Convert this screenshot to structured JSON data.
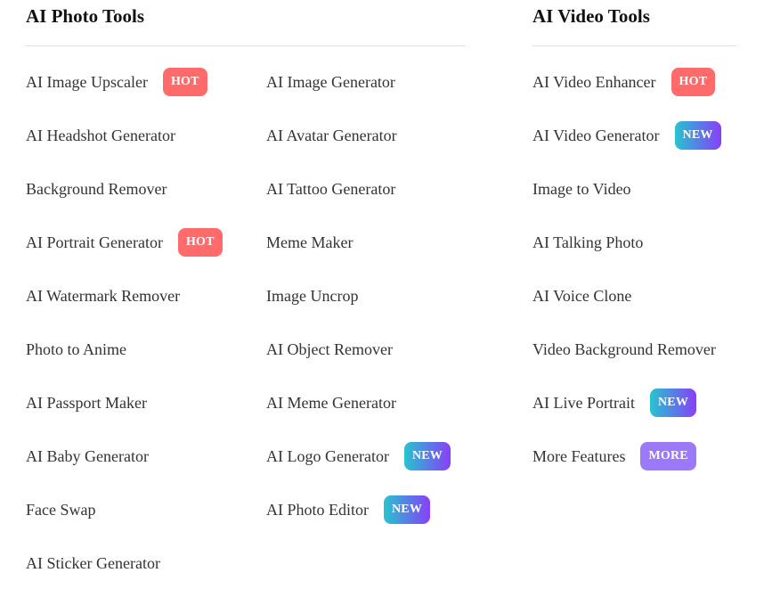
{
  "photo_tools": {
    "title": "AI Photo Tools",
    "columns": [
      [
        {
          "label": "AI Image Upscaler",
          "badge": "HOT",
          "badge_type": "hot"
        },
        {
          "label": "AI Headshot Generator"
        },
        {
          "label": "Background Remover"
        },
        {
          "label": "AI Portrait Generator",
          "badge": "HOT",
          "badge_type": "hot"
        },
        {
          "label": "AI Watermark Remover"
        },
        {
          "label": "Photo to Anime"
        },
        {
          "label": "AI Passport Maker"
        },
        {
          "label": "AI Baby Generator"
        },
        {
          "label": "Face Swap"
        },
        {
          "label": "AI Sticker Generator"
        }
      ],
      [
        {
          "label": "AI Image Generator"
        },
        {
          "label": "AI Avatar Generator"
        },
        {
          "label": "AI Tattoo Generator"
        },
        {
          "label": "Meme Maker"
        },
        {
          "label": "Image Uncrop"
        },
        {
          "label": "AI Object Remover"
        },
        {
          "label": "AI Meme Generator"
        },
        {
          "label": "AI Logo Generator",
          "badge": "NEW",
          "badge_type": "new"
        },
        {
          "label": "AI Photo Editor",
          "badge": "NEW",
          "badge_type": "new"
        }
      ]
    ]
  },
  "video_tools": {
    "title": "AI Video Tools",
    "items": [
      {
        "label": "AI Video Enhancer",
        "badge": "HOT",
        "badge_type": "hot"
      },
      {
        "label": "AI Video Generator",
        "badge": "NEW",
        "badge_type": "new"
      },
      {
        "label": "Image to Video"
      },
      {
        "label": "AI Talking Photo"
      },
      {
        "label": "AI Voice Clone"
      },
      {
        "label": "Video Background Remover"
      },
      {
        "label": "AI Live Portrait",
        "badge": "NEW",
        "badge_type": "new"
      },
      {
        "label": "More Features",
        "badge": "MORE",
        "badge_type": "more"
      }
    ]
  },
  "colors": {
    "hot": "#ff6a6a",
    "new_gradient": [
      "#27c4cf",
      "#8a3ff6"
    ],
    "more": "#9b79f9",
    "text": "#333333",
    "divider": "#dddddd"
  }
}
